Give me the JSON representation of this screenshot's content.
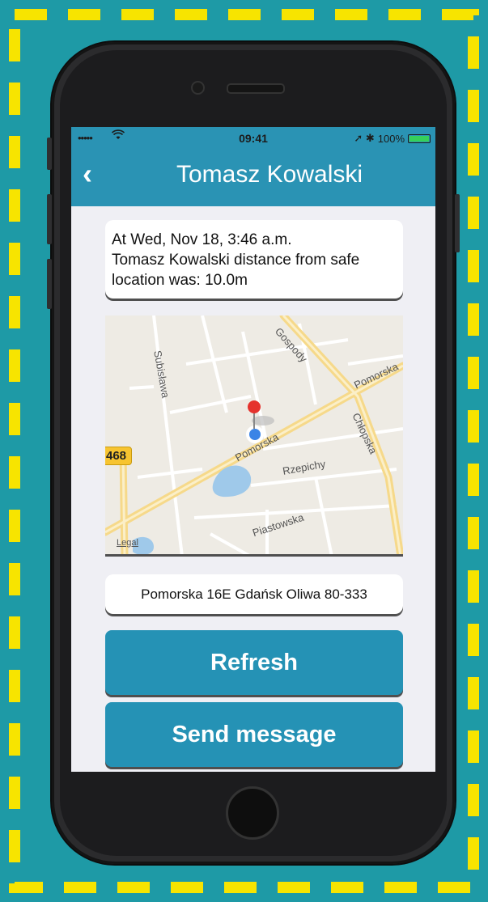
{
  "status_bar": {
    "signal": "•••••",
    "wifi_icon": "wifi-icon",
    "time": "09:41",
    "indicators": "➚ ✱",
    "battery_percent": "100%",
    "battery_level": 100
  },
  "nav": {
    "back_icon": "chevron-left-icon",
    "back_glyph": "‹",
    "title": "Tomasz Kowalski"
  },
  "info": {
    "line1": "At Wed, Nov 18, 3:46 a.m.",
    "line2": "Tomasz Kowalski distance from safe location was: 10.0m"
  },
  "map": {
    "labels": [
      "Subisława",
      "Gospody",
      "Pomorska",
      "Chłopska",
      "Pomorska",
      "Rzepichy",
      "Piastowska"
    ],
    "road_badge": "468",
    "legal": "Legal",
    "pin_icon": "map-pin-icon",
    "location_icon": "current-location-icon"
  },
  "address": "Pomorska 16E Gdańsk Oliwa 80-333",
  "buttons": {
    "refresh": "Refresh",
    "send_message": "Send message"
  },
  "colors": {
    "background": "#1e9aa6",
    "frame_dash": "#f7e400",
    "nav_bar": "#2a93b4",
    "button": "#2592b5"
  }
}
